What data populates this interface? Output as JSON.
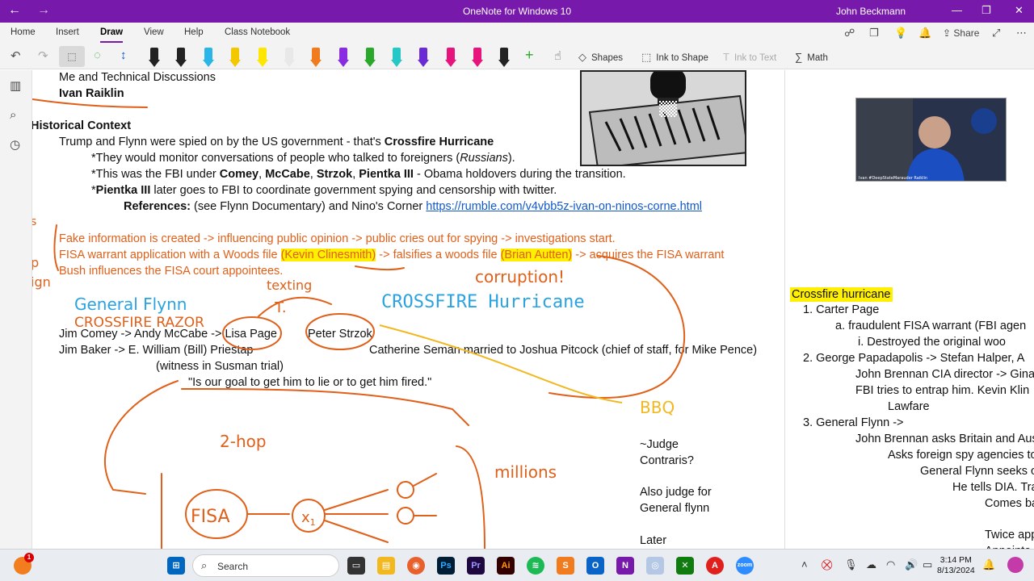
{
  "titlebar": {
    "title": "OneNote for Windows 10",
    "user": "John Beckmann",
    "back_glyph": "←",
    "forward_glyph": "→",
    "minimize_glyph": "—",
    "restore_glyph": "❐",
    "close_glyph": "✕"
  },
  "ribbon": {
    "tabs": [
      "Home",
      "Insert",
      "Draw",
      "View",
      "Help",
      "Class Notebook"
    ],
    "active_tab": "Draw",
    "share_label": "Share",
    "tools": {
      "shapes": "Shapes",
      "ink_to_shape": "Ink to Shape",
      "ink_to_text": "Ink to Text",
      "math": "Math"
    },
    "pens": [
      "#222222",
      "#222222",
      "#2ab5e8",
      "#f3c800",
      "#ffe600",
      "#e8e8e8",
      "#f07c1f",
      "#8a2be2",
      "#2aa82a",
      "#25c7c7",
      "#6a2bd6",
      "#e8147e",
      "#e8147e",
      "#222222"
    ]
  },
  "note": {
    "line1": "Me and Technical Discussions",
    "line2": "Ivan Raiklin",
    "heading": "Historical Context",
    "p1_a": "Trump and Flynn were spied on by the US government - that's ",
    "p1_b": "Crossfire Hurricane",
    "b1_a": "*They would monitor conversations of people who talked to foreigners (",
    "b1_b": "Russians",
    "b1_c": ").",
    "b2_a": "*This was the FBI under ",
    "b2_b": "Comey",
    "b2_c": ", ",
    "b2_d": "McCabe",
    "b2_e": ", ",
    "b2_f": "Strzok",
    "b2_g": ", ",
    "b2_h": "Pientka III",
    "b2_i": " - Obama holdovers during the transition.",
    "b3_a": "*",
    "b3_b": "Pientka III",
    "b3_c": " later goes to FBI to coordinate government spying and censorship with twitter.",
    "ref_label": "References:",
    "ref_text": " (see Flynn Documentary) and Nino's Corner ",
    "ref_link": "https://rumble.com/v4vbb5z-ivan-on-ninos-corne.html",
    "o1": "Fake information is created -> influencing public opinion -> public cries out for spying -> investigations start.",
    "o2_a": "FISA warrant application with a Woods file ",
    "o2_b": "(Kevin Clinesmith)",
    "o2_c": " -> falsifies a woods file ",
    "o2_d": "(Brian Autten)",
    "o2_e": " -> acquires the FISA warrant",
    "o3": "Bush influences the FISA court appointees.",
    "chain1": "Jim Comey -> Andy McCabe -> Lisa Page",
    "peter": "Peter Strzok",
    "chain2": "Jim Baker ->   E. William (Bill) Priestap",
    "catherine": "Catherine Seman married to Joshua Pitcock (chief of staff, for Mike Pence)",
    "witness": "(witness in Susman trial)",
    "quote": "\"Is our goal to get him to lie or to get him fired.\"",
    "judge1": "~Judge",
    "judge2": "Contraris?",
    "judge3": "Also judge for",
    "judge4": "General flynn",
    "later": "Later"
  },
  "ink": {
    "general_flynn": "General Flynn",
    "crossfire_razor": "CROSSFIRE RAZOR",
    "texting": "texting",
    "t": "T.",
    "crossfire_hurricane": "CROSSFIRE Hurricane",
    "corruption": "corruption!",
    "bbq": "BBQ",
    "two_hop": "2-hop",
    "millions": "millions",
    "fisa": "FISA",
    "x1": "x",
    "sub1": "1",
    "left_fragment_1": "p",
    "left_fragment_2": "ign",
    "left_fragment_3": "s",
    "ink_color": "#e0601a",
    "blue_ink": "#2aa3e0"
  },
  "right": {
    "title": "Crossfire hurricane",
    "items": [
      "1.   Carter Page",
      "a.   fraudulent FISA warrant (FBI agen",
      "i.   Destroyed the original woo",
      "2.   George Papadapolis -> Stefan Halper, A",
      "John Brennan CIA director -> Gina",
      "FBI tries to entrap him. Kevin Klin",
      "Lawfare",
      "3.   General Flynn ->",
      "John Brennan asks Britain and Aus",
      "Asks foreign spy agencies to",
      "General Flynn seeks o",
      "He tells DIA. Tra",
      "Comes ba",
      "Twice app",
      "Appointe"
    ],
    "video_caption": "Ivan #DeepStateMarauder Raiklin"
  },
  "taskbar": {
    "search_label": "Search",
    "time": "3:14 PM",
    "date": "8/13/2024",
    "notif_count": "1",
    "apps": [
      "Ps",
      "Pr",
      "Ai",
      "zoom"
    ]
  }
}
